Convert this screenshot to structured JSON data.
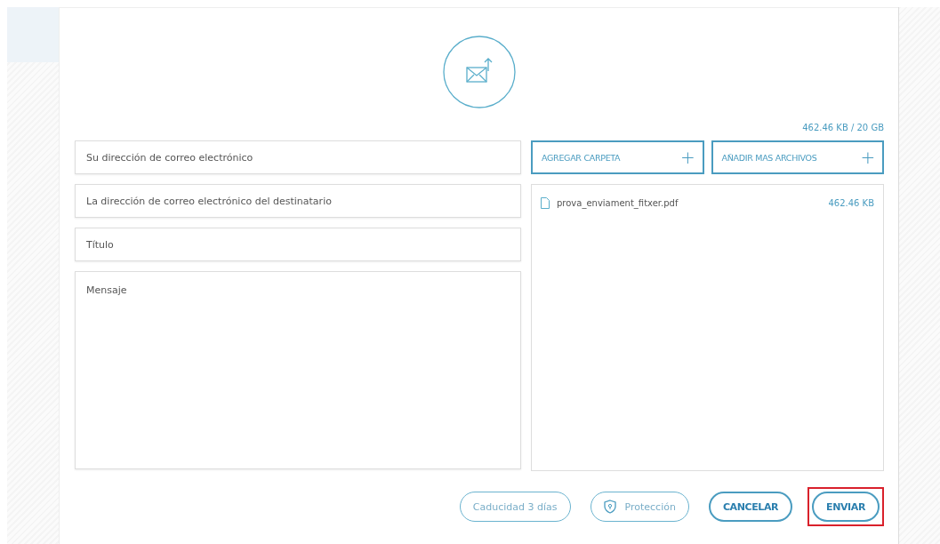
{
  "storage": "462.46 KB / 20 GB",
  "fields": [
    {
      "kind": "input",
      "placeholder": "Su dirección de correo electrónico"
    },
    {
      "kind": "input",
      "placeholder": "La dirección de correo electrónico del destinatario"
    },
    {
      "kind": "input",
      "placeholder": "Título"
    },
    {
      "kind": "textarea",
      "placeholder": "Mensaje"
    }
  ],
  "add_buttons": [
    {
      "label": "AGREGAR CARPETA",
      "icon": "+"
    },
    {
      "label": "AÑADIR MAS ARCHIVOS",
      "icon": "+"
    }
  ],
  "files": [
    {
      "name": "prova_enviament_fitxer.pdf",
      "size": "462.46 KB"
    }
  ],
  "actions": [
    {
      "label": "Caducidad 3 días",
      "kind": "option",
      "highlighted": false
    },
    {
      "label": "Protección",
      "kind": "shield",
      "highlighted": false
    },
    {
      "label": "CANCELAR",
      "kind": "primary",
      "highlighted": false
    },
    {
      "label": "ENVIAR",
      "kind": "primary",
      "highlighted": true
    }
  ]
}
